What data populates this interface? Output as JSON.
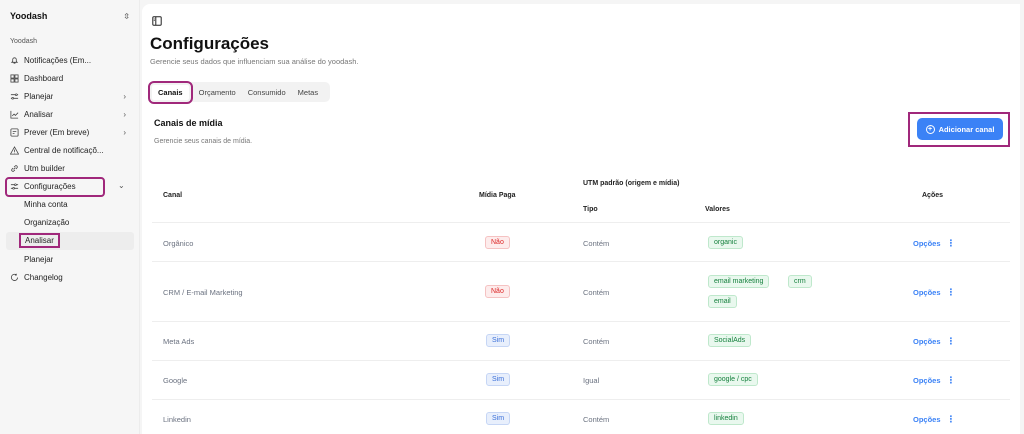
{
  "sidebar": {
    "workspace": "Yoodash",
    "group_label": "Yoodash",
    "items": [
      {
        "label": "Notificações (Em...",
        "icon": "bell-icon",
        "chevron": false
      },
      {
        "label": "Dashboard",
        "icon": "dashboard-icon",
        "chevron": false
      },
      {
        "label": "Planejar",
        "icon": "planner-icon",
        "chevron": true
      },
      {
        "label": "Analisar",
        "icon": "chart-icon",
        "chevron": true
      },
      {
        "label": "Prever (Em breve)",
        "icon": "forecast-icon",
        "chevron": true
      },
      {
        "label": "Central de notificaçõ...",
        "icon": "warning-icon",
        "chevron": false
      },
      {
        "label": "Utm builder",
        "icon": "link-icon",
        "chevron": false
      },
      {
        "label": "Configurações",
        "icon": "settings-icon",
        "chevron": true
      }
    ],
    "subitems": [
      "Minha conta",
      "Organização",
      "Analisar",
      "Planejar"
    ],
    "changelog": "Changelog"
  },
  "page": {
    "title": "Configurações",
    "subtitle": "Gerencie seus dados que influenciam sua análise do yoodash."
  },
  "tabs": [
    "Canais",
    "Orçamento",
    "Consumido",
    "Metas"
  ],
  "section": {
    "title": "Canais de mídia",
    "subtitle": "Gerencie seus canais de mídia.",
    "add_button": "Adicionar canal"
  },
  "table": {
    "headers": {
      "canal": "Canal",
      "midia_paga": "Mídia Paga",
      "utm": "UTM padrão (origem e mídia)",
      "tipo": "Tipo",
      "valores": "Valores",
      "acoes": "Ações"
    },
    "rows": [
      {
        "canal": "Orgânico",
        "paga": "Não",
        "tipo": "Contém",
        "valores": [
          "organic"
        ],
        "acao": "Opções"
      },
      {
        "canal": "CRM / E-mail Marketing",
        "paga": "Não",
        "tipo": "Contém",
        "valores": [
          "email marketing",
          "crm",
          "email"
        ],
        "acao": "Opções"
      },
      {
        "canal": "Meta Ads",
        "paga": "Sim",
        "tipo": "Contém",
        "valores": [
          "SocialAds"
        ],
        "acao": "Opções"
      },
      {
        "canal": "Google",
        "paga": "Sim",
        "tipo": "Igual",
        "valores": [
          "google / cpc"
        ],
        "acao": "Opções"
      },
      {
        "canal": "Linkedin",
        "paga": "Sim",
        "tipo": "Contém",
        "valores": [
          "linkedin"
        ],
        "acao": "Opções"
      }
    ]
  },
  "colors": {
    "accent": "#3b82f6",
    "highlight": "#a0287b",
    "no_badge": "#dc2626",
    "yes_badge": "#3b6fd8",
    "tag_green": "#15803d"
  }
}
